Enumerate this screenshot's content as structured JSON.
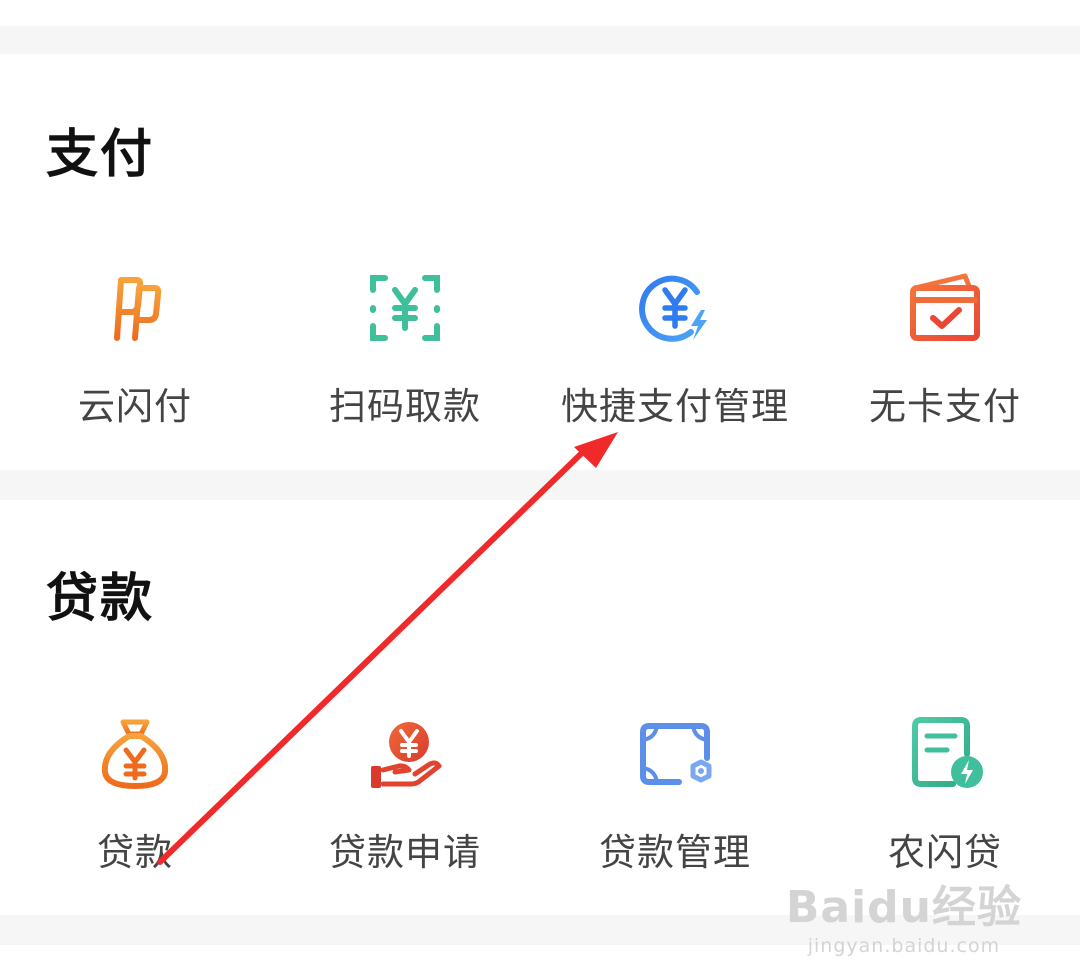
{
  "payment": {
    "title": "支付",
    "items": [
      {
        "label": "云闪付",
        "icon": "cloud-quickpass-icon",
        "color": "#f08a24"
      },
      {
        "label": "扫码取款",
        "icon": "scan-yuan-icon",
        "color": "#3fbf9c"
      },
      {
        "label": "快捷支付管理",
        "icon": "yuan-lightning-icon",
        "color": "#3d7ff0"
      },
      {
        "label": "无卡支付",
        "icon": "card-check-icon",
        "color": "#ef5a3a"
      }
    ]
  },
  "loan": {
    "title": "贷款",
    "items": [
      {
        "label": "贷款",
        "icon": "money-bag-icon",
        "color": "#f07b2a"
      },
      {
        "label": "贷款申请",
        "icon": "hand-coin-icon",
        "color": "#e0442e"
      },
      {
        "label": "贷款管理",
        "icon": "card-gear-icon",
        "color": "#5b8fea"
      },
      {
        "label": "农闪贷",
        "icon": "document-lightning-icon",
        "color": "#3fbf9c"
      }
    ]
  },
  "watermark": {
    "logo_text": "Baidu经验",
    "url": "jingyan.baidu.com"
  }
}
